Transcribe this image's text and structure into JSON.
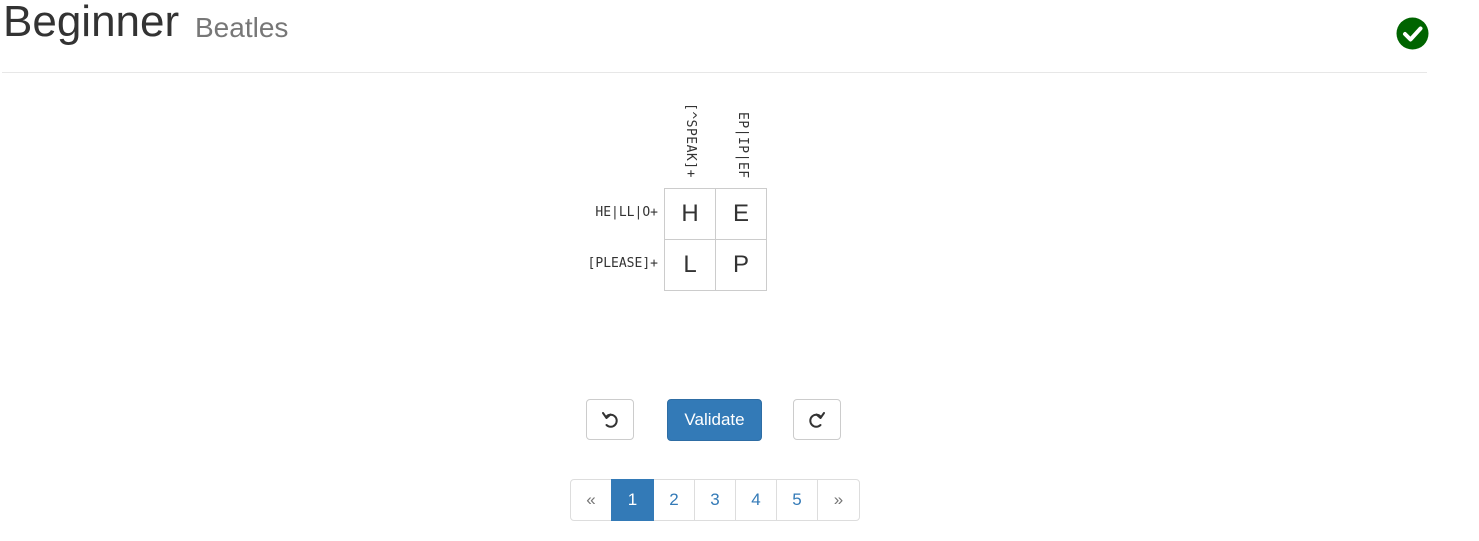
{
  "header": {
    "title": "Beginner",
    "subtitle": "Beatles",
    "status_icon": "check-circle-icon",
    "status_color": "#006400"
  },
  "puzzle": {
    "column_clues": [
      "[^SPEAK]+",
      "EP|IP|EF"
    ],
    "row_clues": [
      "HE|LL|O+",
      "[PLEASE]+"
    ],
    "cells": [
      [
        "H",
        "E"
      ],
      [
        "L",
        "P"
      ]
    ]
  },
  "controls": {
    "undo_icon": "undo-icon",
    "validate_label": "Validate",
    "redo_icon": "redo-icon",
    "accent_color": "#337ab7"
  },
  "pagination": {
    "prev_label": "«",
    "pages": [
      "1",
      "2",
      "3",
      "4",
      "5"
    ],
    "active_page": "1",
    "next_label": "»"
  }
}
